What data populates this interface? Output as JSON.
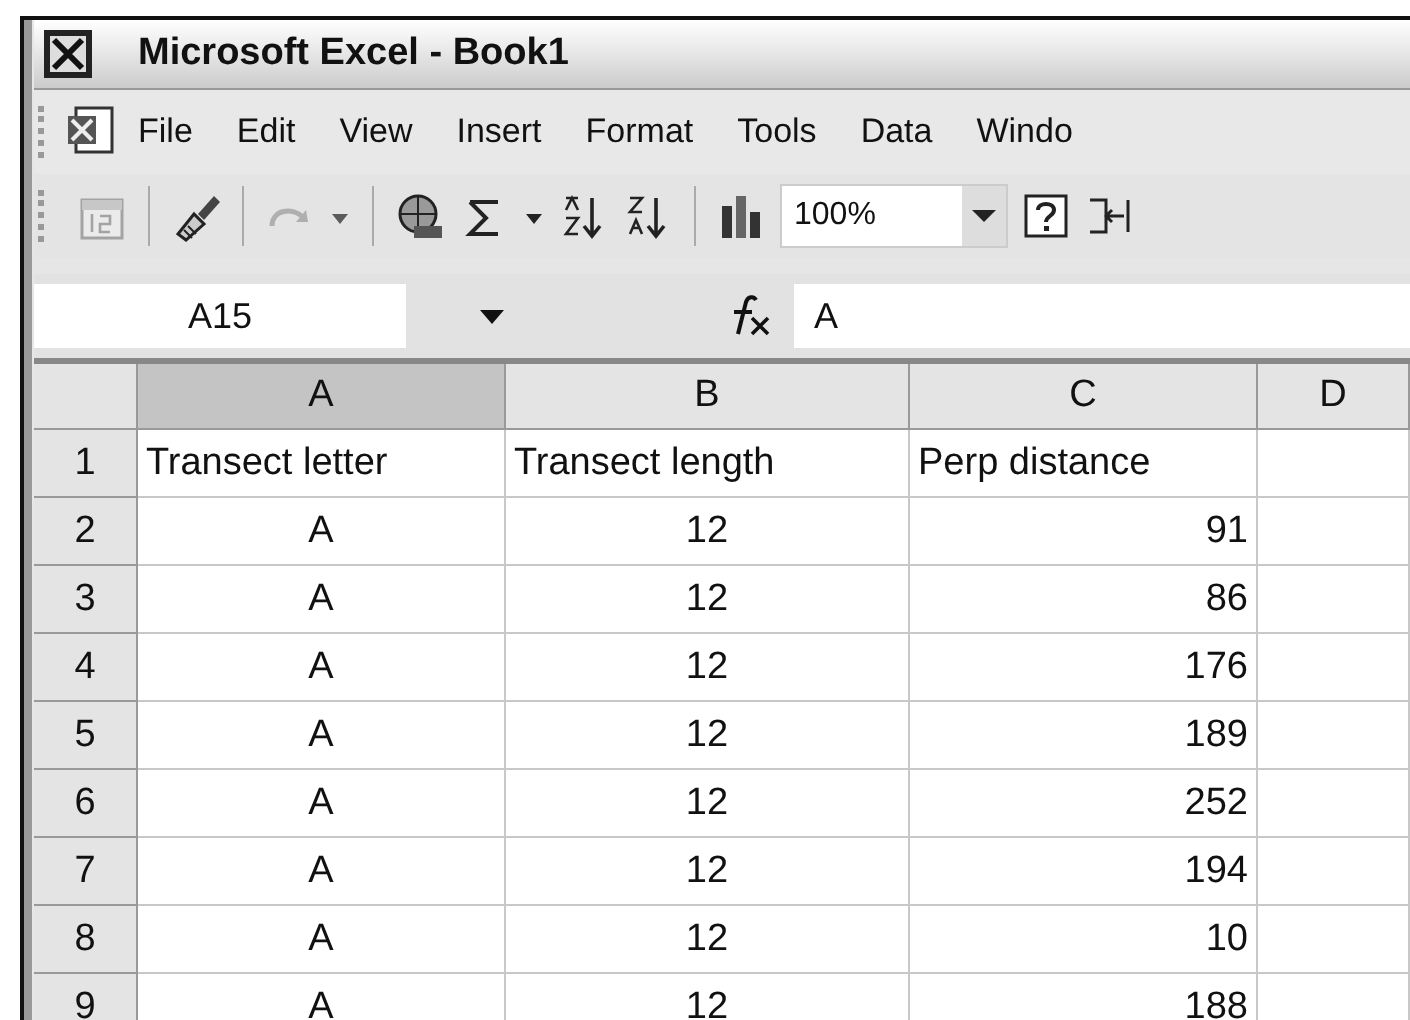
{
  "window": {
    "title": "Microsoft Excel - Book1"
  },
  "menu": [
    {
      "label": "File"
    },
    {
      "label": "Edit"
    },
    {
      "label": "View"
    },
    {
      "label": "Insert"
    },
    {
      "label": "Format"
    },
    {
      "label": "Tools"
    },
    {
      "label": "Data"
    },
    {
      "label": "Windo"
    }
  ],
  "toolbar": [
    {
      "kind": "calendar",
      "disabled": true
    },
    {
      "kind": "separator"
    },
    {
      "kind": "brush",
      "disabled": false
    },
    {
      "kind": "separator"
    },
    {
      "kind": "redo",
      "disabled": true
    },
    {
      "kind": "dropdown",
      "disabled": true
    },
    {
      "kind": "separator"
    },
    {
      "kind": "globe",
      "disabled": false
    },
    {
      "kind": "sigma",
      "disabled": false
    },
    {
      "kind": "dropdown",
      "disabled": false
    },
    {
      "kind": "sort-asc",
      "disabled": false
    },
    {
      "kind": "sort-desc",
      "disabled": false
    },
    {
      "kind": "separator"
    },
    {
      "kind": "chart",
      "disabled": false
    },
    {
      "kind": "zoom",
      "value": "100%"
    },
    {
      "kind": "help",
      "disabled": false
    },
    {
      "kind": "merge",
      "disabled": false
    }
  ],
  "formula_bar": {
    "name_box": "A15",
    "formula": "A"
  },
  "columns": [
    {
      "label": "A",
      "selected": true
    },
    {
      "label": "B",
      "selected": false
    },
    {
      "label": "C",
      "selected": false
    },
    {
      "label": "D",
      "selected": false
    }
  ],
  "rows": [
    {
      "number": "1",
      "kind": "header",
      "cells": [
        "Transect letter",
        "Transect length",
        "Perp distance"
      ]
    },
    {
      "number": "2",
      "cells": [
        "A",
        "12",
        "91"
      ]
    },
    {
      "number": "3",
      "cells": [
        "A",
        "12",
        "86"
      ]
    },
    {
      "number": "4",
      "cells": [
        "A",
        "12",
        "176"
      ]
    },
    {
      "number": "5",
      "cells": [
        "A",
        "12",
        "189"
      ]
    },
    {
      "number": "6",
      "cells": [
        "A",
        "12",
        "252"
      ]
    },
    {
      "number": "7",
      "cells": [
        "A",
        "12",
        "194"
      ]
    },
    {
      "number": "8",
      "cells": [
        "A",
        "12",
        "10"
      ]
    },
    {
      "number": "9",
      "cells": [
        "A",
        "12",
        "188"
      ]
    }
  ]
}
